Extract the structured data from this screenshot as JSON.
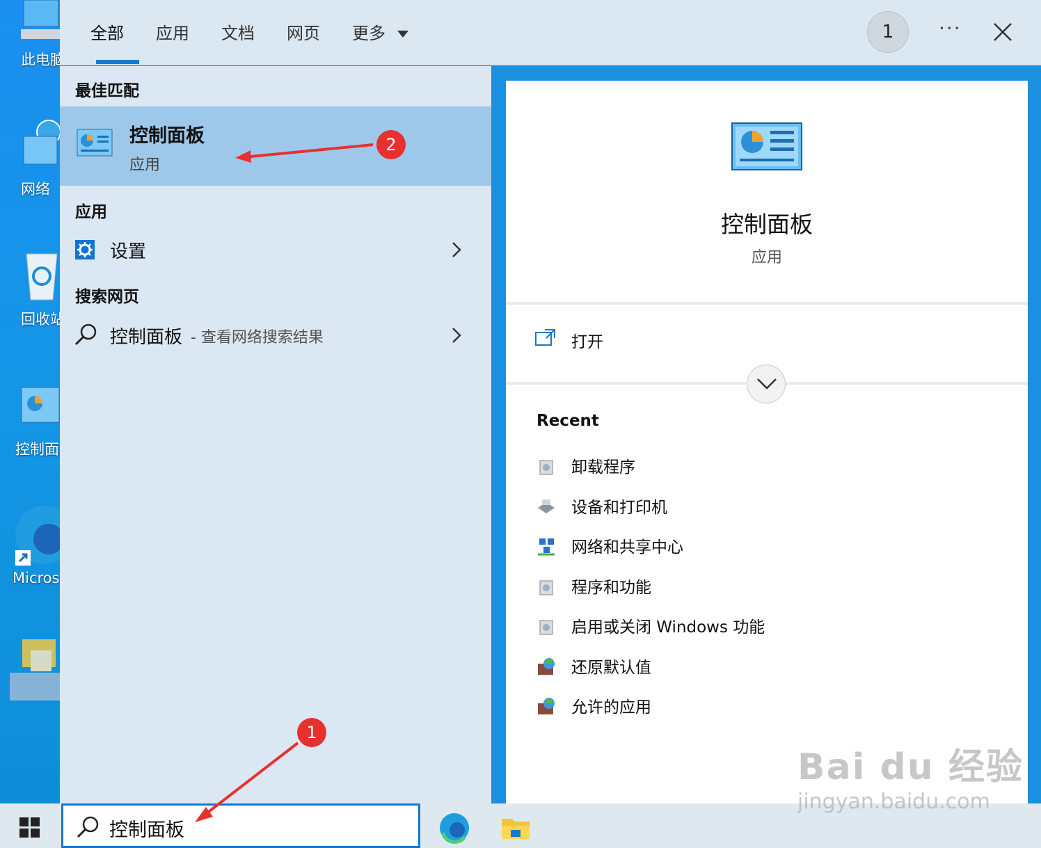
{
  "desktop": {
    "icons": [
      {
        "label": "此电脑"
      },
      {
        "label": "网络"
      },
      {
        "label": "回收站"
      },
      {
        "label": "控制面板"
      },
      {
        "label": "Microsoft Edge"
      }
    ]
  },
  "tabs": {
    "items": [
      "全部",
      "应用",
      "文档",
      "网页",
      "更多"
    ],
    "badge": "1",
    "more_label": "···"
  },
  "left": {
    "best_match_heading": "最佳匹配",
    "best_match": {
      "title": "控制面板",
      "subtitle": "应用"
    },
    "apps_heading": "应用",
    "apps": [
      {
        "label": "设置"
      }
    ],
    "web_heading": "搜索网页",
    "web_result": {
      "query": "控制面板",
      "suffix": "- 查看网络搜索结果"
    }
  },
  "right": {
    "title": "控制面板",
    "subtitle": "应用",
    "open_label": "打开",
    "recent_heading": "Recent",
    "recent_items": [
      {
        "label": "卸载程序",
        "icon": "programs-icon"
      },
      {
        "label": "设备和打印机",
        "icon": "printer-icon"
      },
      {
        "label": "网络和共享中心",
        "icon": "network-icon"
      },
      {
        "label": "程序和功能",
        "icon": "programs-icon"
      },
      {
        "label": "启用或关闭 Windows 功能",
        "icon": "programs-icon"
      },
      {
        "label": "还原默认值",
        "icon": "firewall-icon"
      },
      {
        "label": "允许的应用",
        "icon": "firewall-icon"
      }
    ]
  },
  "taskbar": {
    "search_value": "控制面板"
  },
  "annotations": {
    "step1": "1",
    "step2": "2"
  },
  "watermark": {
    "brand": "Bai du 经验",
    "url": "jingyan.baidu.com"
  },
  "colors": {
    "accent": "#0f7dd6",
    "selected": "#9ec8ea",
    "annotation": "#e8302f"
  }
}
